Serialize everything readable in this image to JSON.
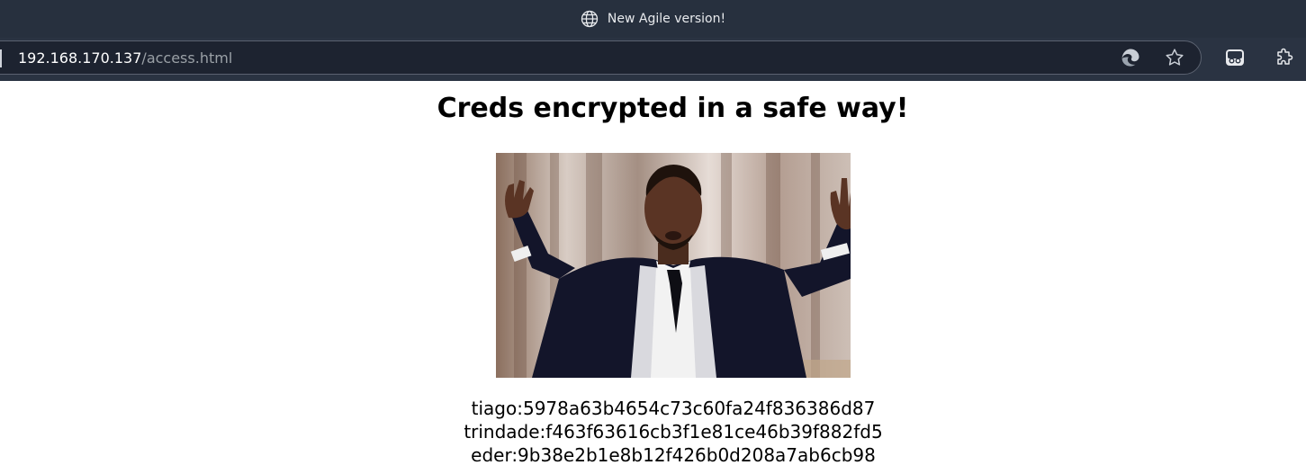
{
  "browser": {
    "tab_title": "New Agile version!",
    "url_host": "192.168.170.137",
    "url_path": "/access.html"
  },
  "page": {
    "heading": "Creds encrypted in a safe way!",
    "credentials": [
      "tiago:5978a63b4654c73c60fa24f836386d87",
      "trindade:f463f63616cb3f1e81ce46b39f882fd5",
      "eder:9b38e2b1e8b12f426b0d208a7ab6cb98"
    ]
  },
  "colors": {
    "chrome_bg": "#2a3342",
    "address_bg": "#1d2330",
    "page_bg": "#ffffff"
  }
}
